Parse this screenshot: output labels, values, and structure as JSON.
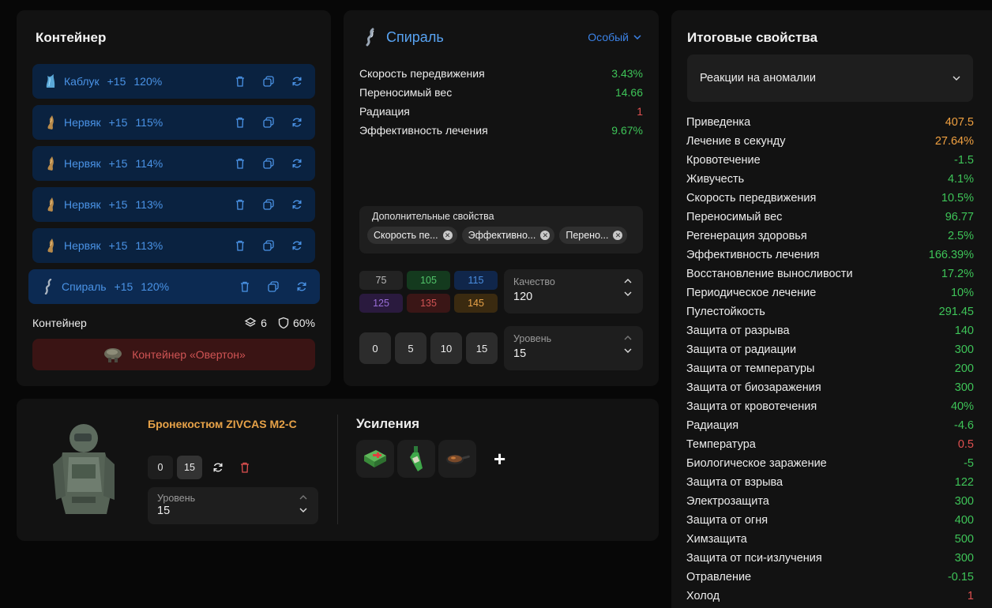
{
  "container_panel": {
    "title": "Контейнер",
    "artifacts": [
      {
        "icon": "kabluk-artifact-icon",
        "name": "Каблук",
        "level": "+15",
        "quality": "120%",
        "color": "#4a93e6"
      },
      {
        "icon": "nervyak-artifact-icon",
        "name": "Нервяк",
        "level": "+15",
        "quality": "115%",
        "color": "#4a93e6"
      },
      {
        "icon": "nervyak-artifact-icon",
        "name": "Нервяк",
        "level": "+15",
        "quality": "114%",
        "color": "#4a93e6"
      },
      {
        "icon": "nervyak-artifact-icon",
        "name": "Нервяк",
        "level": "+15",
        "quality": "113%",
        "color": "#4a93e6"
      },
      {
        "icon": "nervyak-artifact-icon",
        "name": "Нервяк",
        "level": "+15",
        "quality": "113%",
        "color": "#4a93e6"
      },
      {
        "icon": "spiral-artifact-icon",
        "name": "Спираль",
        "level": "+15",
        "quality": "120%",
        "color": "#4a93e6"
      }
    ],
    "footer_label": "Контейнер",
    "slots": "6",
    "protection": "60%",
    "container_button": "Контейнер «Овертон»"
  },
  "spiral_panel": {
    "title": "Спираль",
    "rarity": "Особый",
    "properties": [
      {
        "name": "Скорость передвижения",
        "value": "3.43%",
        "tone": "green"
      },
      {
        "name": "Переносимый вес",
        "value": "14.66",
        "tone": "green"
      },
      {
        "name": "Радиация",
        "value": "1",
        "tone": "red"
      },
      {
        "name": "Эффективность лечения",
        "value": "9.67%",
        "tone": "green"
      }
    ],
    "extra_label": "Дополнительные свойства",
    "extra_tags": [
      "Скорость пе...",
      "Эффективно...",
      "Перено..."
    ],
    "quality_presets": [
      {
        "value": "75",
        "bg": "#232323",
        "fg": "#b8b8b8"
      },
      {
        "value": "105",
        "bg": "#143a1e",
        "fg": "#52c46a"
      },
      {
        "value": "115",
        "bg": "#10264a",
        "fg": "#4a8ee0"
      },
      {
        "value": "125",
        "bg": "#2a1a3e",
        "fg": "#9a6ed8"
      },
      {
        "value": "135",
        "bg": "#3a1616",
        "fg": "#d05454"
      },
      {
        "value": "145",
        "bg": "#3a2a10",
        "fg": "#e7a248"
      }
    ],
    "quality_label": "Качество",
    "quality_value": "120",
    "level_buttons": [
      "0",
      "5",
      "10",
      "15"
    ],
    "level_label": "Уровень",
    "level_value": "15"
  },
  "armor_panel": {
    "name": "Бронекостюм ZIVCAS M2-C",
    "level_buttons": [
      "0",
      "15"
    ],
    "level_label": "Уровень",
    "level_value": "15",
    "boosts_title": "Усиления",
    "boosts": [
      "medkit-icon",
      "bottle-icon",
      "frying-pan-icon"
    ],
    "add_label": "+"
  },
  "totals_panel": {
    "title": "Итоговые свойства",
    "dropdown": "Реакции на аномалии",
    "rows": [
      {
        "name": "Приведенка",
        "value": "407.5",
        "tone": "orange"
      },
      {
        "name": "Лечение в секунду",
        "value": "27.64%",
        "tone": "orange"
      },
      {
        "name": "Кровотечение",
        "value": "-1.5",
        "tone": "green"
      },
      {
        "name": "Живучесть",
        "value": "4.1%",
        "tone": "green"
      },
      {
        "name": "Скорость передвижения",
        "value": "10.5%",
        "tone": "green"
      },
      {
        "name": "Переносимый вес",
        "value": "96.77",
        "tone": "green"
      },
      {
        "name": "Регенерация здоровья",
        "value": "2.5%",
        "tone": "green"
      },
      {
        "name": "Эффективность лечения",
        "value": "166.39%",
        "tone": "green"
      },
      {
        "name": "Восстановление выносливости",
        "value": "17.2%",
        "tone": "green"
      },
      {
        "name": "Периодическое лечение",
        "value": "10%",
        "tone": "green"
      },
      {
        "name": "Пулестойкость",
        "value": "291.45",
        "tone": "green"
      },
      {
        "name": "Защита от разрыва",
        "value": "140",
        "tone": "green"
      },
      {
        "name": "Защита от радиации",
        "value": "300",
        "tone": "green"
      },
      {
        "name": "Защита от температуры",
        "value": "200",
        "tone": "green"
      },
      {
        "name": "Защита от биозаражения",
        "value": "300",
        "tone": "green"
      },
      {
        "name": "Защита от кровотечения",
        "value": "40%",
        "tone": "green"
      },
      {
        "name": "Радиация",
        "value": "-4.6",
        "tone": "green"
      },
      {
        "name": "Температура",
        "value": "0.5",
        "tone": "red"
      },
      {
        "name": "Биологическое заражение",
        "value": "-5",
        "tone": "green"
      },
      {
        "name": "Защита от взрыва",
        "value": "122",
        "tone": "green"
      },
      {
        "name": "Электрозащита",
        "value": "300",
        "tone": "green"
      },
      {
        "name": "Защита от огня",
        "value": "400",
        "tone": "green"
      },
      {
        "name": "Химзащита",
        "value": "500",
        "tone": "green"
      },
      {
        "name": "Защита от пси-излучения",
        "value": "300",
        "tone": "green"
      },
      {
        "name": "Отравление",
        "value": "-0.15",
        "tone": "green"
      },
      {
        "name": "Холод",
        "value": "1",
        "tone": "red"
      }
    ]
  },
  "colors": {
    "accent_blue": "#4a93e6",
    "positive": "#3ec458",
    "negative": "#e05050",
    "highlight": "#f0a040"
  }
}
